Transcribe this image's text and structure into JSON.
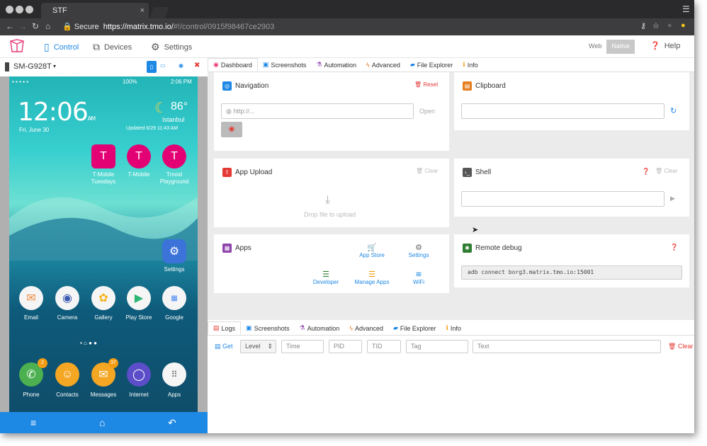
{
  "browser": {
    "tab_title": "STF",
    "tab_close": "×",
    "url_secure": "Secure",
    "url_host": "https://matrix.tmo.io/",
    "url_path": "#!/control/0915f98467ce2903"
  },
  "header": {
    "control": "Control",
    "devices": "Devices",
    "settings": "Settings",
    "web": "Web",
    "native": "Native",
    "help": "Help"
  },
  "device": {
    "name": "SM-G928T",
    "status_time": "2:06 PM",
    "status_battery": "100%",
    "clock": "12:06",
    "clock_ampm": "AM",
    "date": "Fri, June 30",
    "temp": "86°",
    "city": "Istanbul",
    "updated": "Updated 6/29 11:43 AM",
    "apps_row1": [
      {
        "label": "T-Mobile Tuesdays",
        "color": "#e20074",
        "icon": "T"
      },
      {
        "label": "T-Mobile",
        "color": "#e20074",
        "icon": "T"
      },
      {
        "label": "Tmoid Playground",
        "color": "#e20074",
        "icon": "T"
      }
    ],
    "settings_label": "Settings",
    "apps_row2": [
      {
        "label": "Email",
        "color": "#f5f5f5"
      },
      {
        "label": "Camera",
        "color": "#f5f5f5"
      },
      {
        "label": "Gallery",
        "color": "#f5f5f5"
      },
      {
        "label": "Play Store",
        "color": "#f5f5f5"
      },
      {
        "label": "Google",
        "color": "#f5f5f5"
      }
    ],
    "dock": [
      {
        "label": "Phone",
        "color": "#4caf50",
        "badge": "2"
      },
      {
        "label": "Contacts",
        "color": "#f5a623",
        "badge": ""
      },
      {
        "label": "Messages",
        "color": "#f5a623",
        "badge": "37"
      },
      {
        "label": "Internet",
        "color": "#5c4ec9",
        "badge": ""
      },
      {
        "label": "Apps",
        "color": "#f5f5f5",
        "badge": ""
      }
    ]
  },
  "tabs": [
    "Dashboard",
    "Screenshots",
    "Automation",
    "Advanced",
    "File Explorer",
    "Info"
  ],
  "tabs_bottom": [
    "Logs",
    "Screenshots",
    "Automation",
    "Advanced",
    "File Explorer",
    "Info"
  ],
  "navigation": {
    "title": "Navigation",
    "reset": "Reset",
    "placeholder": "http://...",
    "open": "Open"
  },
  "clipboard": {
    "title": "Clipboard"
  },
  "upload": {
    "title": "App Upload",
    "clear": "Clear",
    "drop": "Drop file to upload"
  },
  "shell": {
    "title": "Shell",
    "clear": "Clear"
  },
  "apps": {
    "title": "Apps",
    "links": [
      "App Store",
      "Settings",
      "Developer",
      "Manage Apps",
      "WiFi"
    ]
  },
  "remote": {
    "title": "Remote debug",
    "command": "adb connect borg3.matrix.tmo.io:15001"
  },
  "logs": {
    "get": "Get",
    "level": "Level",
    "time": "Time",
    "pid": "PID",
    "tid": "TID",
    "tag": "Tag",
    "text": "Text",
    "clear": "Clear"
  },
  "colors": {
    "accent": "#1e88e5",
    "danger": "#e53935",
    "tmobile": "#e20074"
  }
}
